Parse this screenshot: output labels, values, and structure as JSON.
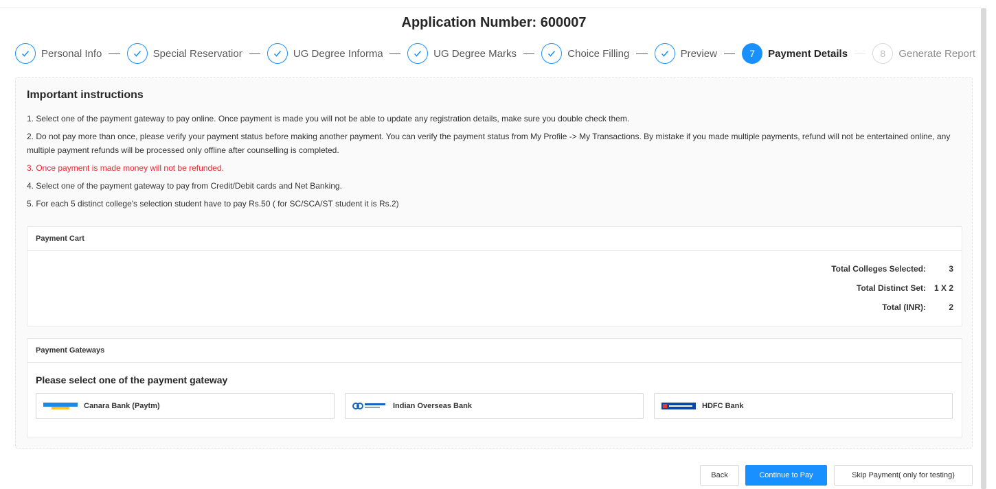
{
  "header": {
    "title": "Application Number: 600007"
  },
  "steps": [
    {
      "label": "Personal Info",
      "status": "done"
    },
    {
      "label": "Special Reservation",
      "status": "done"
    },
    {
      "label": "UG Degree Information",
      "status": "done"
    },
    {
      "label": "UG Degree Marks",
      "status": "done"
    },
    {
      "label": "Choice Filling",
      "status": "done"
    },
    {
      "label": "Preview",
      "status": "done"
    },
    {
      "number": "7",
      "label": "Payment Details",
      "status": "active"
    },
    {
      "number": "8",
      "label": "Generate Report",
      "status": "wait"
    }
  ],
  "instructions": {
    "heading": "Important instructions",
    "items": [
      "1. Select one of the payment gateway to pay online. Once payment is made you will not be able to update any registration details, make sure you double check them.",
      "2. Do not pay more than once, please verify your payment status before making another payment. You can verify the payment status from My Profile -> My Transactions. By mistake if you made multiple payments, refund will not be entertained online, any multiple payment refunds will be processed only offline after counselling is completed.",
      "3. Once payment is made money will not be refunded.",
      "4. Select one of the payment gateway to pay from Credit/Debit cards and Net Banking.",
      "5. For each 5 distinct college's selection student have to pay Rs.50 ( for SC/SCA/ST student it is Rs.2)"
    ]
  },
  "cart": {
    "header": "Payment Cart",
    "rows": [
      {
        "label": "Total Colleges Selected:",
        "value": "3"
      },
      {
        "label": "Total Distinct Set:",
        "value": "1 X 2"
      },
      {
        "label": "Total (INR):",
        "value": "2"
      }
    ]
  },
  "gateways": {
    "header": "Payment Gateways",
    "title": "Please select one of the payment gateway",
    "options": [
      {
        "label": "Canara Bank (Paytm)",
        "icon": "canara-bank-logo"
      },
      {
        "label": "Indian Overseas Bank",
        "icon": "iob-logo"
      },
      {
        "label": "HDFC Bank",
        "icon": "hdfc-bank-logo"
      }
    ]
  },
  "buttons": {
    "back": "Back",
    "continue": "Continue to Pay",
    "skip": "Skip Payment( only for testing)"
  },
  "colors": {
    "primary": "#1890ff",
    "warning_text": "#f5222d"
  }
}
